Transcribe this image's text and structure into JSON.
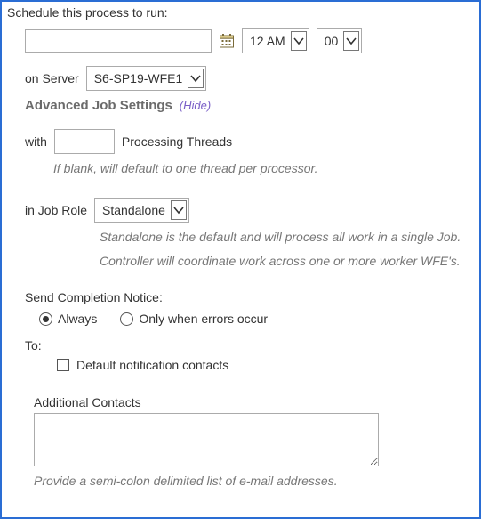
{
  "schedule": {
    "heading": "Schedule this process to run:",
    "date_value": "",
    "hour_selected": "12 AM",
    "minute_selected": "00",
    "server_label": "on Server",
    "server_selected": "S6-SP19-WFE1"
  },
  "advanced": {
    "heading": "Advanced Job Settings",
    "toggle_label": "Hide",
    "threads": {
      "prefix": "with",
      "value": "",
      "suffix": "Processing Threads",
      "helper": "If blank, will default to one thread per processor."
    },
    "jobrole": {
      "label": "in Job Role",
      "selected": "Standalone",
      "helper1": "Standalone is the default and will process all work in a single Job.",
      "helper2": "Controller will coordinate work across one or more worker WFE's."
    }
  },
  "notice": {
    "heading": "Send Completion Notice:",
    "option_always": "Always",
    "option_errors": "Only when errors occur",
    "selected": "always",
    "to_label": "To:",
    "default_contacts_label": "Default notification contacts",
    "default_contacts_checked": false,
    "additional_label": "Additional Contacts",
    "additional_value": "",
    "additional_helper": "Provide a semi-colon delimited list of e-mail addresses."
  },
  "icons": {
    "calendar": "calendar-icon",
    "chevron_down": "chevron-down-icon"
  }
}
